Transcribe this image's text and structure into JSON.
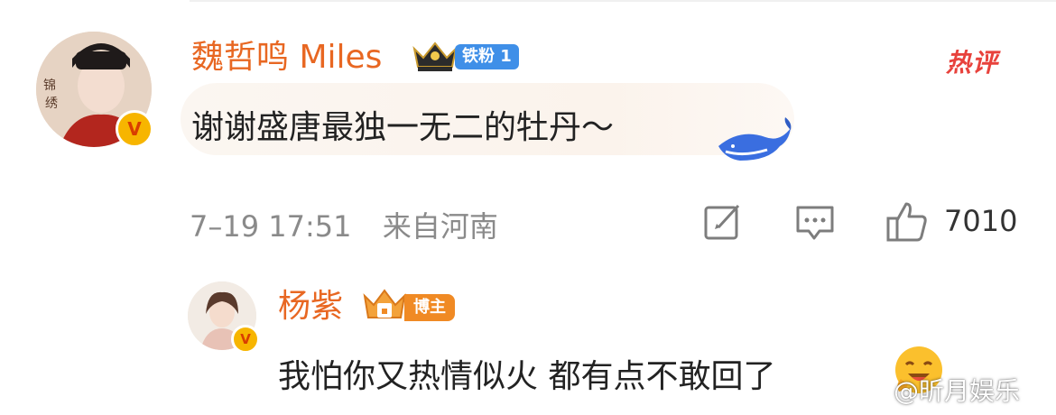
{
  "comment": {
    "author": "魏哲鸣 Miles",
    "fan_badge": "铁粉 1",
    "hot_label": "热评",
    "text": "谢谢盛唐最独一无二的牡丹～",
    "time": "7–19  17:51",
    "location": "来自河南",
    "like_count": "7010",
    "avatar_text": "锦绣芳华 刘畅",
    "verified_mark": "V"
  },
  "reply": {
    "author": "杨紫",
    "badge": "博主",
    "text": "我怕你又热情似火 都有点不敢回了",
    "verified_mark": "V"
  },
  "watermark": "@昕月娱乐",
  "colors": {
    "name": "#e86722",
    "fan_badge": "#3f8fe8",
    "blogger_badge": "#f08a24",
    "hot": "#e8423c",
    "meta": "#8a8a8a"
  },
  "icons": [
    "share-icon",
    "comment-icon",
    "like-icon",
    "whale-icon",
    "smile-emoji-icon",
    "crown-icon"
  ]
}
